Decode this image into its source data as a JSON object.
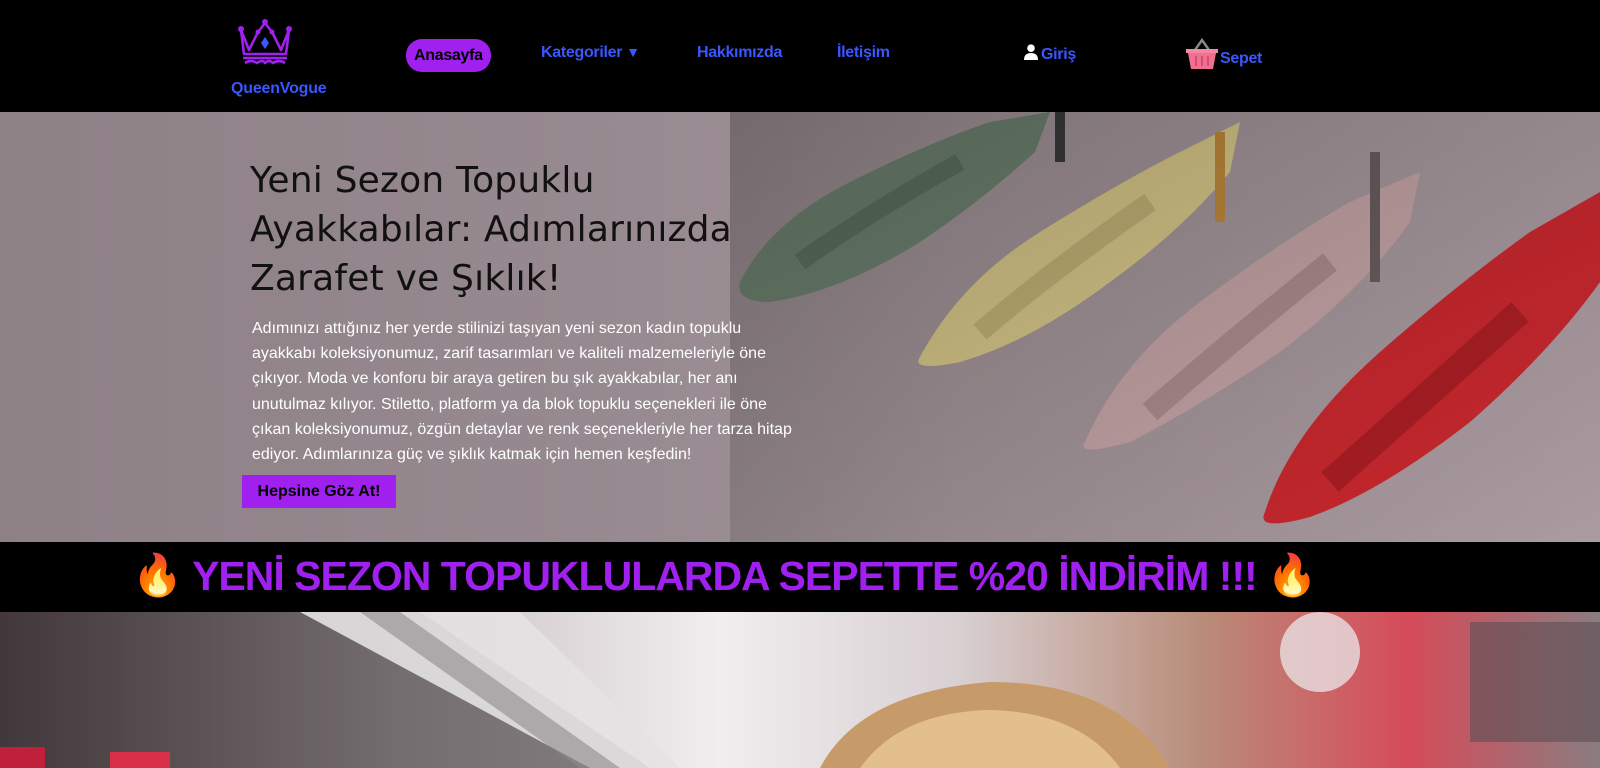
{
  "brand": {
    "name": "QueenVogue"
  },
  "nav": {
    "home": "Anasayfa",
    "categories": "Kategoriler",
    "categories_caret": "▼",
    "about": "Hakkımızda",
    "contact": "İletişim",
    "login": "Giriş",
    "cart": "Sepet"
  },
  "hero": {
    "title": "Yeni Sezon Topuklu Ayakkabılar: Adımlarınızda Zarafet ve Şıklık!",
    "description": "Adımınızı attığınız her yerde stilinizi taşıyan yeni sezon kadın topuklu ayakkabı koleksiyonumuz, zarif tasarımları ve kaliteli malzemeleriyle öne çıkıyor. Moda ve konforu bir araya getiren bu şık ayakkabılar, her anı unutulmaz kılıyor. Stiletto, platform ya da blok topuklu seçenekleri ile öne çıkan koleksiyonumuz, özgün detaylar ve renk seçenekleriyle her tarza hitap ediyor. Adımlarınıza güç ve şıklık katmak için hemen keşfedin!",
    "button": "Hepsine Göz At!"
  },
  "promo": {
    "icon_left": "🔥",
    "text": "YENİ SEZON TOPUKLULARDA SEPETTE %20 İNDİRİM !!!",
    "icon_right": "🔥"
  },
  "colors": {
    "accent": "#a020f0",
    "link": "#3a57ff",
    "background": "#000000"
  }
}
